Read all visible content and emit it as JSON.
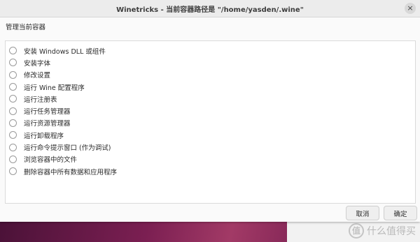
{
  "window": {
    "title": "Winetricks - 当前容器路径是 \"/home/yasden/.wine\"",
    "close_icon": "×"
  },
  "group_label": "管理当前容器",
  "items": [
    {
      "label": "安装 Windows DLL 或组件",
      "selected": false
    },
    {
      "label": "安装字体",
      "selected": false
    },
    {
      "label": "修改设置",
      "selected": false
    },
    {
      "label": "运行 Wine 配置程序",
      "selected": false
    },
    {
      "label": "运行注册表",
      "selected": false
    },
    {
      "label": "运行任务管理器",
      "selected": false
    },
    {
      "label": "运行资源管理器",
      "selected": false
    },
    {
      "label": "运行卸载程序",
      "selected": false
    },
    {
      "label": "运行命令提示窗口 (作为调试)",
      "selected": false
    },
    {
      "label": "浏览容器中的文件",
      "selected": false
    },
    {
      "label": "删除容器中所有数据和应用程序",
      "selected": false
    }
  ],
  "buttons": {
    "cancel": "取消",
    "ok": "确定"
  },
  "watermark": {
    "icon": "值",
    "text": "什么值得买"
  }
}
